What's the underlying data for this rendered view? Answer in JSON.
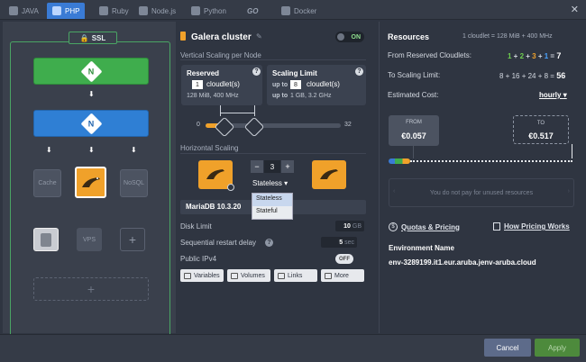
{
  "tabs": [
    {
      "label": "JAVA",
      "icon": "java-icon"
    },
    {
      "label": "PHP",
      "icon": "php-icon",
      "active": true
    },
    {
      "label": "Ruby",
      "icon": "ruby-icon"
    },
    {
      "label": "Node.js",
      "icon": "nodejs-icon"
    },
    {
      "label": "Python",
      "icon": "python-icon"
    },
    {
      "label": "GO",
      "icon": "go-icon"
    },
    {
      "label": "Docker",
      "icon": "docker-icon"
    }
  ],
  "topology": {
    "ssl_label": "SSL",
    "balancer_icon_text": "N",
    "nodes": {
      "cache": "Cache",
      "nosql": "NoSQL",
      "vps": "VPS"
    },
    "add_symbol": "+"
  },
  "config": {
    "node_title": "Galera cluster",
    "on_label": "ON",
    "vertical_label": "Vertical Scaling per Node",
    "reserved": {
      "title": "Reserved",
      "value": "1",
      "unit": "cloudlet(s)",
      "info": "128 MiB, 400 MHz"
    },
    "scaling_limit": {
      "title": "Scaling Limit",
      "prefix": "up to",
      "value": "8",
      "unit": "cloudlet(s)",
      "info_prefix": "up to",
      "info": "1 GB, 3.2 GHz"
    },
    "slider": {
      "min_label": "0",
      "max_label": "32",
      "reserved": 1,
      "limit": 8,
      "max": 32
    },
    "horizontal_label": "Horizontal Scaling",
    "node_count": "3",
    "minus": "−",
    "plus": "+",
    "mode": "Stateless",
    "mode_options": [
      "Stateless",
      "Stateful"
    ],
    "version": "MariaDB 10.3.20",
    "disk_limit_label": "Disk Limit",
    "disk_value": "10",
    "disk_unit": "GB",
    "restart_label": "Sequential restart delay",
    "restart_value": "5",
    "restart_unit": "sec",
    "ipv4_label": "Public IPv4",
    "off_label": "OFF",
    "buttons": [
      "Variables",
      "Volumes",
      "Links",
      "More"
    ]
  },
  "resources": {
    "title": "Resources",
    "cloudlet_def": "1 cloudlet = 128 MiB + 400 MHz",
    "from_label": "From Reserved Cloudlets:",
    "from_terms": [
      "1",
      "2",
      "3",
      "1"
    ],
    "from_total": "7",
    "to_label": "To Scaling Limit:",
    "to_expr": "8 + 16 + 24 + 8 =",
    "to_total": "56",
    "cost_label": "Estimated Cost:",
    "cost_period": "hourly",
    "from_box": {
      "label": "FROM",
      "value": "€0.057"
    },
    "to_box": {
      "label": "TO",
      "value": "€0.517"
    },
    "unused_text": "You do not pay for unused resources",
    "quotas_link": "Quotas & Pricing",
    "how_link": "How Pricing Works",
    "env_label": "Environment Name",
    "env_value": "env-3289199.it1.eur.aruba.jenv-aruba.cloud"
  },
  "footer": {
    "cancel": "Cancel",
    "apply": "Apply"
  },
  "colors": {
    "accent": "#3a7bd5",
    "green": "#3fad4d",
    "orange": "#f0a12a",
    "blue_lb": "#2f7fd4"
  }
}
